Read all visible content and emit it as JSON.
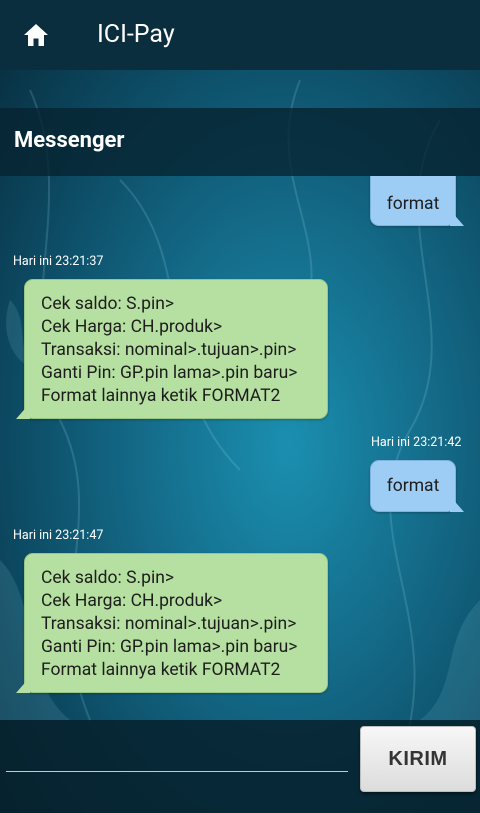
{
  "appbar": {
    "title": "ICI-Pay",
    "home_icon": "home-icon"
  },
  "section": {
    "title": "Messenger"
  },
  "messages": [
    {
      "type": "outgoing",
      "text": "format",
      "partial": true
    },
    {
      "type": "incoming",
      "time": "Hari ini 23:21:37",
      "lines": [
        "Cek saldo: S.pin>",
        "Cek Harga: CH.produk>",
        "Transaksi: nominal>.tujuan>.pin>",
        "Ganti Pin: GP.pin lama>.pin baru>",
        "Format lainnya ketik FORMAT2"
      ]
    },
    {
      "type": "outgoing",
      "time": "Hari ini 23:21:42",
      "text": "format"
    },
    {
      "type": "incoming",
      "time": "Hari ini 23:21:47",
      "lines": [
        "Cek saldo: S.pin>",
        "Cek Harga: CH.produk>",
        "Transaksi: nominal>.tujuan>.pin>",
        "Ganti Pin: GP.pin lama>.pin baru>",
        "Format lainnya ketik FORMAT2"
      ]
    }
  ],
  "composer": {
    "input_value": "",
    "send_label": "KIRIM"
  },
  "colors": {
    "appbar": "#0b2e3e",
    "incoming_bubble": "#b6e0a1",
    "outgoing_bubble": "#9dcdf5"
  }
}
